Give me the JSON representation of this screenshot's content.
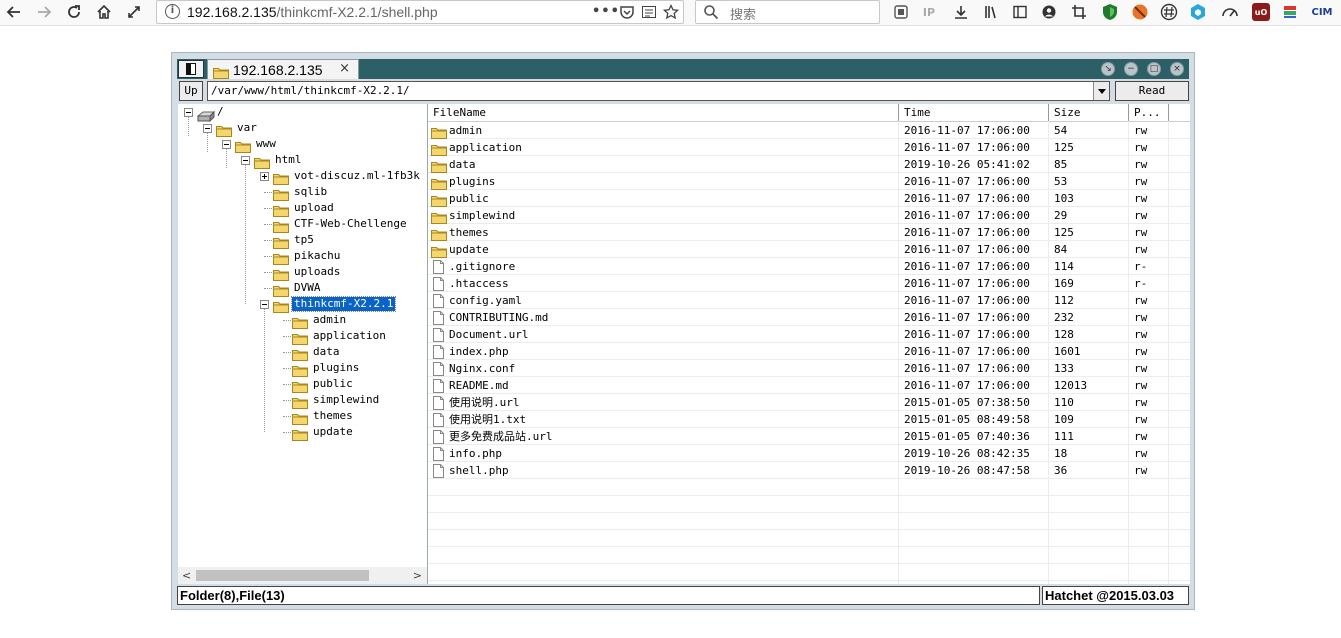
{
  "browser": {
    "url_host": "192.168.2.135",
    "url_path": "/thinkcmf-X2.2.1/shell.php",
    "search_placeholder": "搜索",
    "reader_label": "IP",
    "ext_label_cim": "CIM",
    "ext_label_ub": "uO"
  },
  "app": {
    "tab_label": "192.168.2.135",
    "tab_close": "×",
    "up_label": "Up",
    "path_value": "/var/www/html/thinkcmf-X2.2.1/",
    "read_label": "Read",
    "status_left": "Folder(8),File(13)",
    "status_right": "Hatchet @2015.03.03"
  },
  "tree": {
    "root": "/",
    "var": "var",
    "www": "www",
    "html": "html",
    "html_children": [
      "vot-discuz.ml-1fb3k",
      "sqlib",
      "upload",
      "CTF-Web-Chellenge",
      "tp5",
      "pikachu",
      "uploads",
      "DVWA",
      "thinkcmf-X2.2.1"
    ],
    "thinkcmf_children": [
      "admin",
      "application",
      "data",
      "plugins",
      "public",
      "simplewind",
      "themes",
      "update"
    ]
  },
  "list": {
    "columns": [
      "FileName",
      "Time",
      "Size",
      "P..."
    ],
    "rows": [
      {
        "name": "admin",
        "time": "2016-11-07 17:06:00",
        "size": "54",
        "perm": "rw",
        "type": "folder"
      },
      {
        "name": "application",
        "time": "2016-11-07 17:06:00",
        "size": "125",
        "perm": "rw",
        "type": "folder"
      },
      {
        "name": "data",
        "time": "2019-10-26 05:41:02",
        "size": "85",
        "perm": "rw",
        "type": "folder"
      },
      {
        "name": "plugins",
        "time": "2016-11-07 17:06:00",
        "size": "53",
        "perm": "rw",
        "type": "folder"
      },
      {
        "name": "public",
        "time": "2016-11-07 17:06:00",
        "size": "103",
        "perm": "rw",
        "type": "folder"
      },
      {
        "name": "simplewind",
        "time": "2016-11-07 17:06:00",
        "size": "29",
        "perm": "rw",
        "type": "folder"
      },
      {
        "name": "themes",
        "time": "2016-11-07 17:06:00",
        "size": "125",
        "perm": "rw",
        "type": "folder"
      },
      {
        "name": "update",
        "time": "2016-11-07 17:06:00",
        "size": "84",
        "perm": "rw",
        "type": "folder"
      },
      {
        "name": ".gitignore",
        "time": "2016-11-07 17:06:00",
        "size": "114",
        "perm": "r-",
        "type": "file"
      },
      {
        "name": ".htaccess",
        "time": "2016-11-07 17:06:00",
        "size": "169",
        "perm": "r-",
        "type": "file"
      },
      {
        "name": "config.yaml",
        "time": "2016-11-07 17:06:00",
        "size": "112",
        "perm": "rw",
        "type": "file"
      },
      {
        "name": "CONTRIBUTING.md",
        "time": "2016-11-07 17:06:00",
        "size": "232",
        "perm": "rw",
        "type": "file"
      },
      {
        "name": "Document.url",
        "time": "2016-11-07 17:06:00",
        "size": "128",
        "perm": "rw",
        "type": "file"
      },
      {
        "name": "index.php",
        "time": "2016-11-07 17:06:00",
        "size": "1601",
        "perm": "rw",
        "type": "file"
      },
      {
        "name": "Nginx.conf",
        "time": "2016-11-07 17:06:00",
        "size": "133",
        "perm": "rw",
        "type": "file"
      },
      {
        "name": "README.md",
        "time": "2016-11-07 17:06:00",
        "size": "12013",
        "perm": "rw",
        "type": "file"
      },
      {
        "name": "使用说明.url",
        "time": "2015-01-05 07:38:50",
        "size": "110",
        "perm": "rw",
        "type": "file"
      },
      {
        "name": "使用说明1.txt",
        "time": "2015-01-05 08:49:58",
        "size": "109",
        "perm": "rw",
        "type": "file"
      },
      {
        "name": "更多免费成品站.url",
        "time": "2015-01-05 07:40:36",
        "size": "111",
        "perm": "rw",
        "type": "file"
      },
      {
        "name": "info.php",
        "time": "2019-10-26 08:42:35",
        "size": "18",
        "perm": "rw",
        "type": "file"
      },
      {
        "name": "shell.php",
        "time": "2019-10-26 08:47:58",
        "size": "36",
        "perm": "rw",
        "type": "file"
      }
    ]
  },
  "colors": {
    "titlebar": "#2c5f66",
    "selection": "#0a64c8",
    "window_frame": "#d4dde3"
  }
}
